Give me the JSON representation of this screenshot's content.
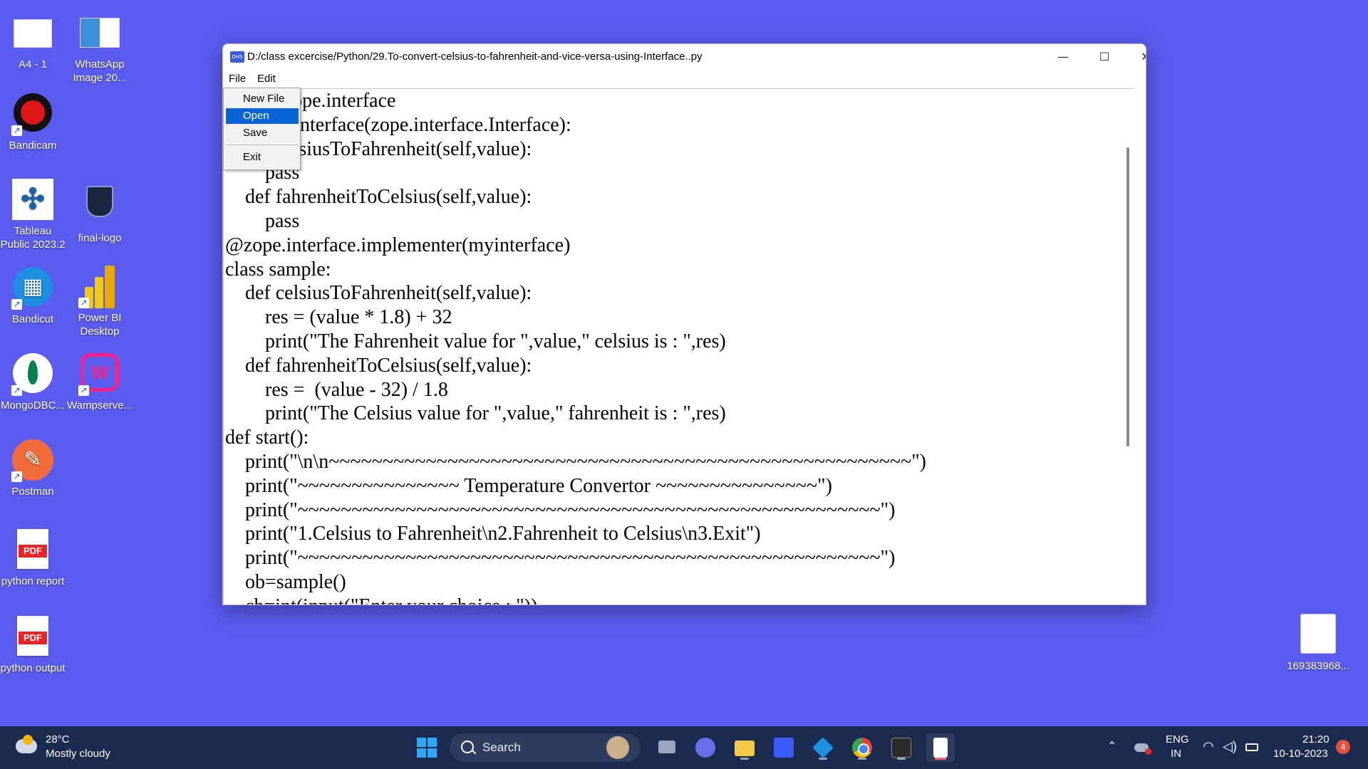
{
  "desktop": {
    "icons_left_col1": [
      "A4 - 1",
      "Bandicam",
      "Tableau Public 2023.2",
      "Bandicut",
      "MongoDBC...",
      "Postman",
      "python report",
      "python output"
    ],
    "icons_left_col2": [
      "WhatsApp Image 20...",
      "final-logo",
      "Power BI Desktop",
      "Wampserve..."
    ],
    "icon_right": "169383968..."
  },
  "window": {
    "title": "D:/class excercise/Python/29.To-convert-celsius-to-fahrenheit-and-vice-versa-using-Interface..py",
    "app_icon_text": "DHS",
    "controls": {
      "minimize": "—",
      "maximize": "☐",
      "close": "✕"
    }
  },
  "menubar": {
    "file": "File",
    "edit": "Edit"
  },
  "file_menu": {
    "new_file": "New File",
    "open": "Open",
    "save": "Save",
    "exit": "Exit"
  },
  "editor": {
    "lines": [
      "import zope.interface",
      "class myinterface(zope.interface.Interface):",
      "    def celsiusToFahrenheit(self,value):",
      "        pass",
      "    def fahrenheitToCelsius(self,value):",
      "        pass",
      "@zope.interface.implementer(myinterface)",
      "class sample:",
      "    def celsiusToFahrenheit(self,value):",
      "        res = (value * 1.8) + 32",
      "        print(\"The Fahrenheit value for \",value,\" celsius is : \",res)",
      "    def fahrenheitToCelsius(self,value):",
      "        res =  (value - 32) / 1.8",
      "        print(\"The Celsius value for \",value,\" fahrenheit is : \",res)",
      "def start():",
      "    print(\"\\n\\n~~~~~~~~~~~~~~~~~~~~~~~~~~~~~~~~~~~~~~~~~~~~~~~~~~~~~~\")",
      "    print(\"~~~~~~~~~~~~~~~ Temperature Convertor ~~~~~~~~~~~~~~~\")",
      "    print(\"~~~~~~~~~~~~~~~~~~~~~~~~~~~~~~~~~~~~~~~~~~~~~~~~~~~~~~\")",
      "    print(\"1.Celsius to Fahrenheit\\n2.Fahrenheit to Celsius\\n3.Exit\")",
      "    print(\"~~~~~~~~~~~~~~~~~~~~~~~~~~~~~~~~~~~~~~~~~~~~~~~~~~~~~~\")",
      "    ob=sample()",
      "    ch=int(input(\"Enter your choice : \"))"
    ]
  },
  "taskbar": {
    "weather_temp": "28°C",
    "weather_desc": "Mostly cloudy",
    "search_label": "Search",
    "lang_top": "ENG",
    "lang_bottom": "IN",
    "time": "21:20",
    "date": "10-10-2023",
    "notification_count": "4"
  }
}
